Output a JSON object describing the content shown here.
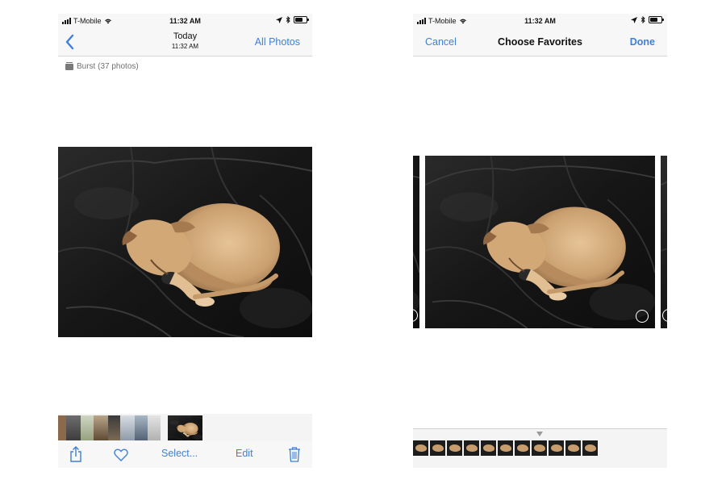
{
  "left": {
    "status": {
      "carrier": "T-Mobile",
      "time": "11:32 AM"
    },
    "nav": {
      "title": "Today",
      "subtitle": "11:32 AM",
      "right_label": "All Photos"
    },
    "burst_label": "Burst (37 photos)",
    "toolbar": {
      "select_label": "Select...",
      "edit_label": "Edit"
    }
  },
  "right": {
    "status": {
      "carrier": "T-Mobile",
      "time": "11:32 AM"
    },
    "nav": {
      "cancel_label": "Cancel",
      "title": "Choose Favorites",
      "done_label": "Done"
    }
  },
  "colors": {
    "accent": "#3f7fd6",
    "bar_bg": "#f7f7f7"
  },
  "icons": {
    "back": "chevron-left-icon",
    "share": "share-icon",
    "favorite": "heart-icon",
    "delete": "trash-icon",
    "burst": "burst-stack-icon",
    "wifi": "wifi-icon",
    "location": "location-arrow-icon",
    "bluetooth": "bluetooth-icon",
    "battery": "battery-icon"
  },
  "battery_level": 0.7,
  "burst_strip_frames": 11
}
